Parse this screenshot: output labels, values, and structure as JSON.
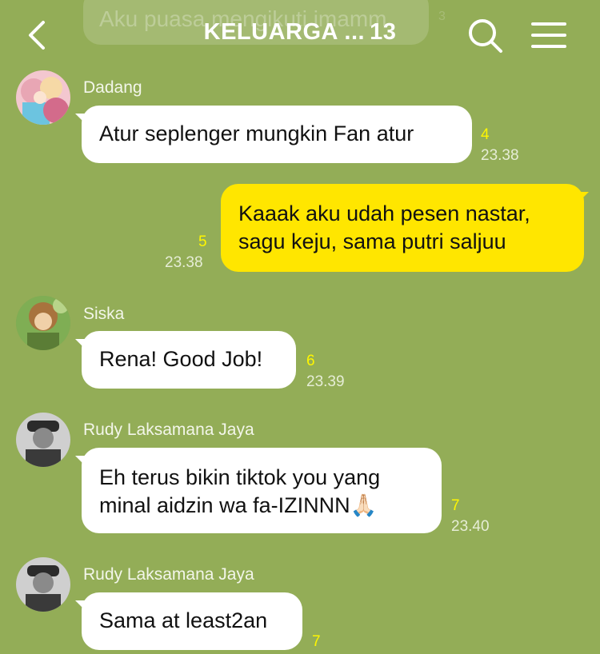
{
  "header": {
    "title": "KELUARGA ...",
    "member_count": "13",
    "back_icon": "chevron-left-icon",
    "search_icon": "search-icon",
    "menu_icon": "hamburger-menu-icon"
  },
  "previous_message": {
    "text": "Aku puasa mengikuti imamm",
    "read": "3"
  },
  "messages": [
    {
      "sender": "Dadang",
      "text": "Atur seplenger mungkin Fan atur",
      "read": "4",
      "time": "23.38",
      "mine": false
    },
    {
      "sender": "",
      "text": "Kaaak aku udah pesen nastar,\nsagu keju, sama putri saljuu",
      "read": "5",
      "time": "23.38",
      "mine": true
    },
    {
      "sender": "Siska",
      "text": "Rena! Good Job!",
      "read": "6",
      "time": "23.39",
      "mine": false
    },
    {
      "sender": "Rudy Laksamana Jaya",
      "text": "Eh terus bikin tiktok you yang\nminal aidzin wa fa-IZINNN🙏🏻",
      "read": "7",
      "time": "23.40",
      "mine": false
    },
    {
      "sender": "Rudy Laksamana Jaya",
      "text": "Sama at least2an",
      "read": "7",
      "time": "",
      "mine": false
    }
  ],
  "colors": {
    "background": "#93ad57",
    "bubble_other": "#ffffff",
    "bubble_mine": "#ffe600",
    "read_count": "#fff600"
  }
}
